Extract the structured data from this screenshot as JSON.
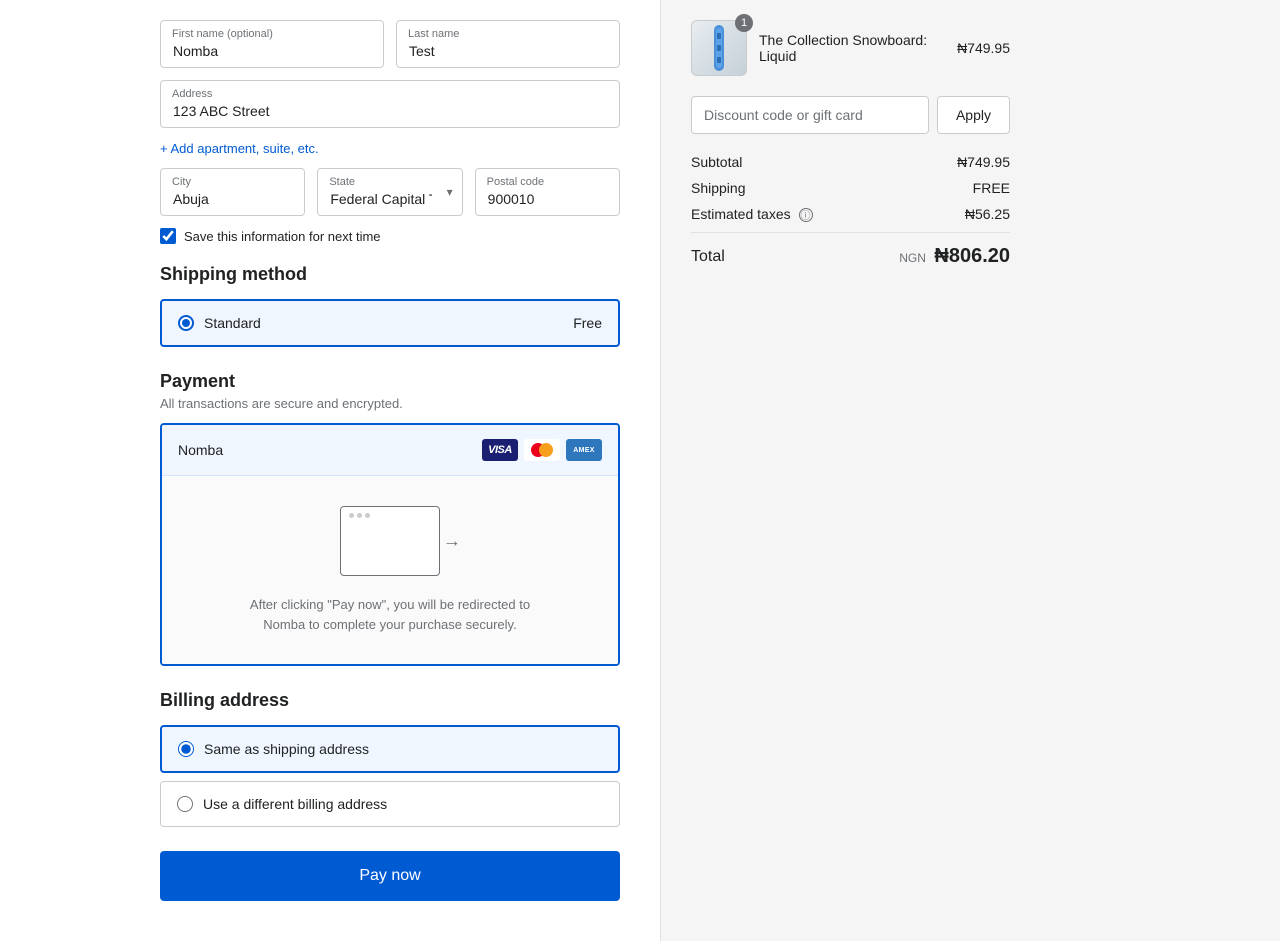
{
  "form": {
    "first_name_label": "First name (optional)",
    "first_name_value": "Nomba",
    "last_name_label": "Last name",
    "last_name_value": "Test",
    "address_label": "Address",
    "address_value": "123 ABC Street",
    "add_apartment_label": "+ Add apartment, suite, etc.",
    "city_label": "City",
    "city_value": "Abuja",
    "state_label": "State",
    "state_value": "Federal Capital Terri...",
    "postal_label": "Postal code",
    "postal_value": "900010",
    "save_info_label": "Save this information for next time"
  },
  "shipping": {
    "section_title": "Shipping method",
    "option_label": "Standard",
    "option_price": "Free"
  },
  "payment": {
    "section_title": "Payment",
    "section_subtitle": "All transactions are secure and encrypted.",
    "option_name": "Nomba",
    "redirect_text": "After clicking \"Pay now\", you will be redirected to\nNomba to complete your purchase securely."
  },
  "billing": {
    "section_title": "Billing address",
    "same_address_label": "Same as shipping address",
    "different_address_label": "Use a different billing address"
  },
  "pay_button_label": "Pay now",
  "order": {
    "product_name": "The Collection Snowboard: Liquid",
    "product_price": "₦749.95",
    "badge_count": "1",
    "discount_placeholder": "Discount code or gift card",
    "apply_label": "Apply",
    "subtotal_label": "Subtotal",
    "subtotal_value": "₦749.95",
    "shipping_label": "Shipping",
    "shipping_value": "FREE",
    "taxes_label": "Estimated taxes",
    "taxes_value": "₦56.25",
    "total_label": "Total",
    "total_currency": "NGN",
    "total_value": "₦806.20"
  }
}
